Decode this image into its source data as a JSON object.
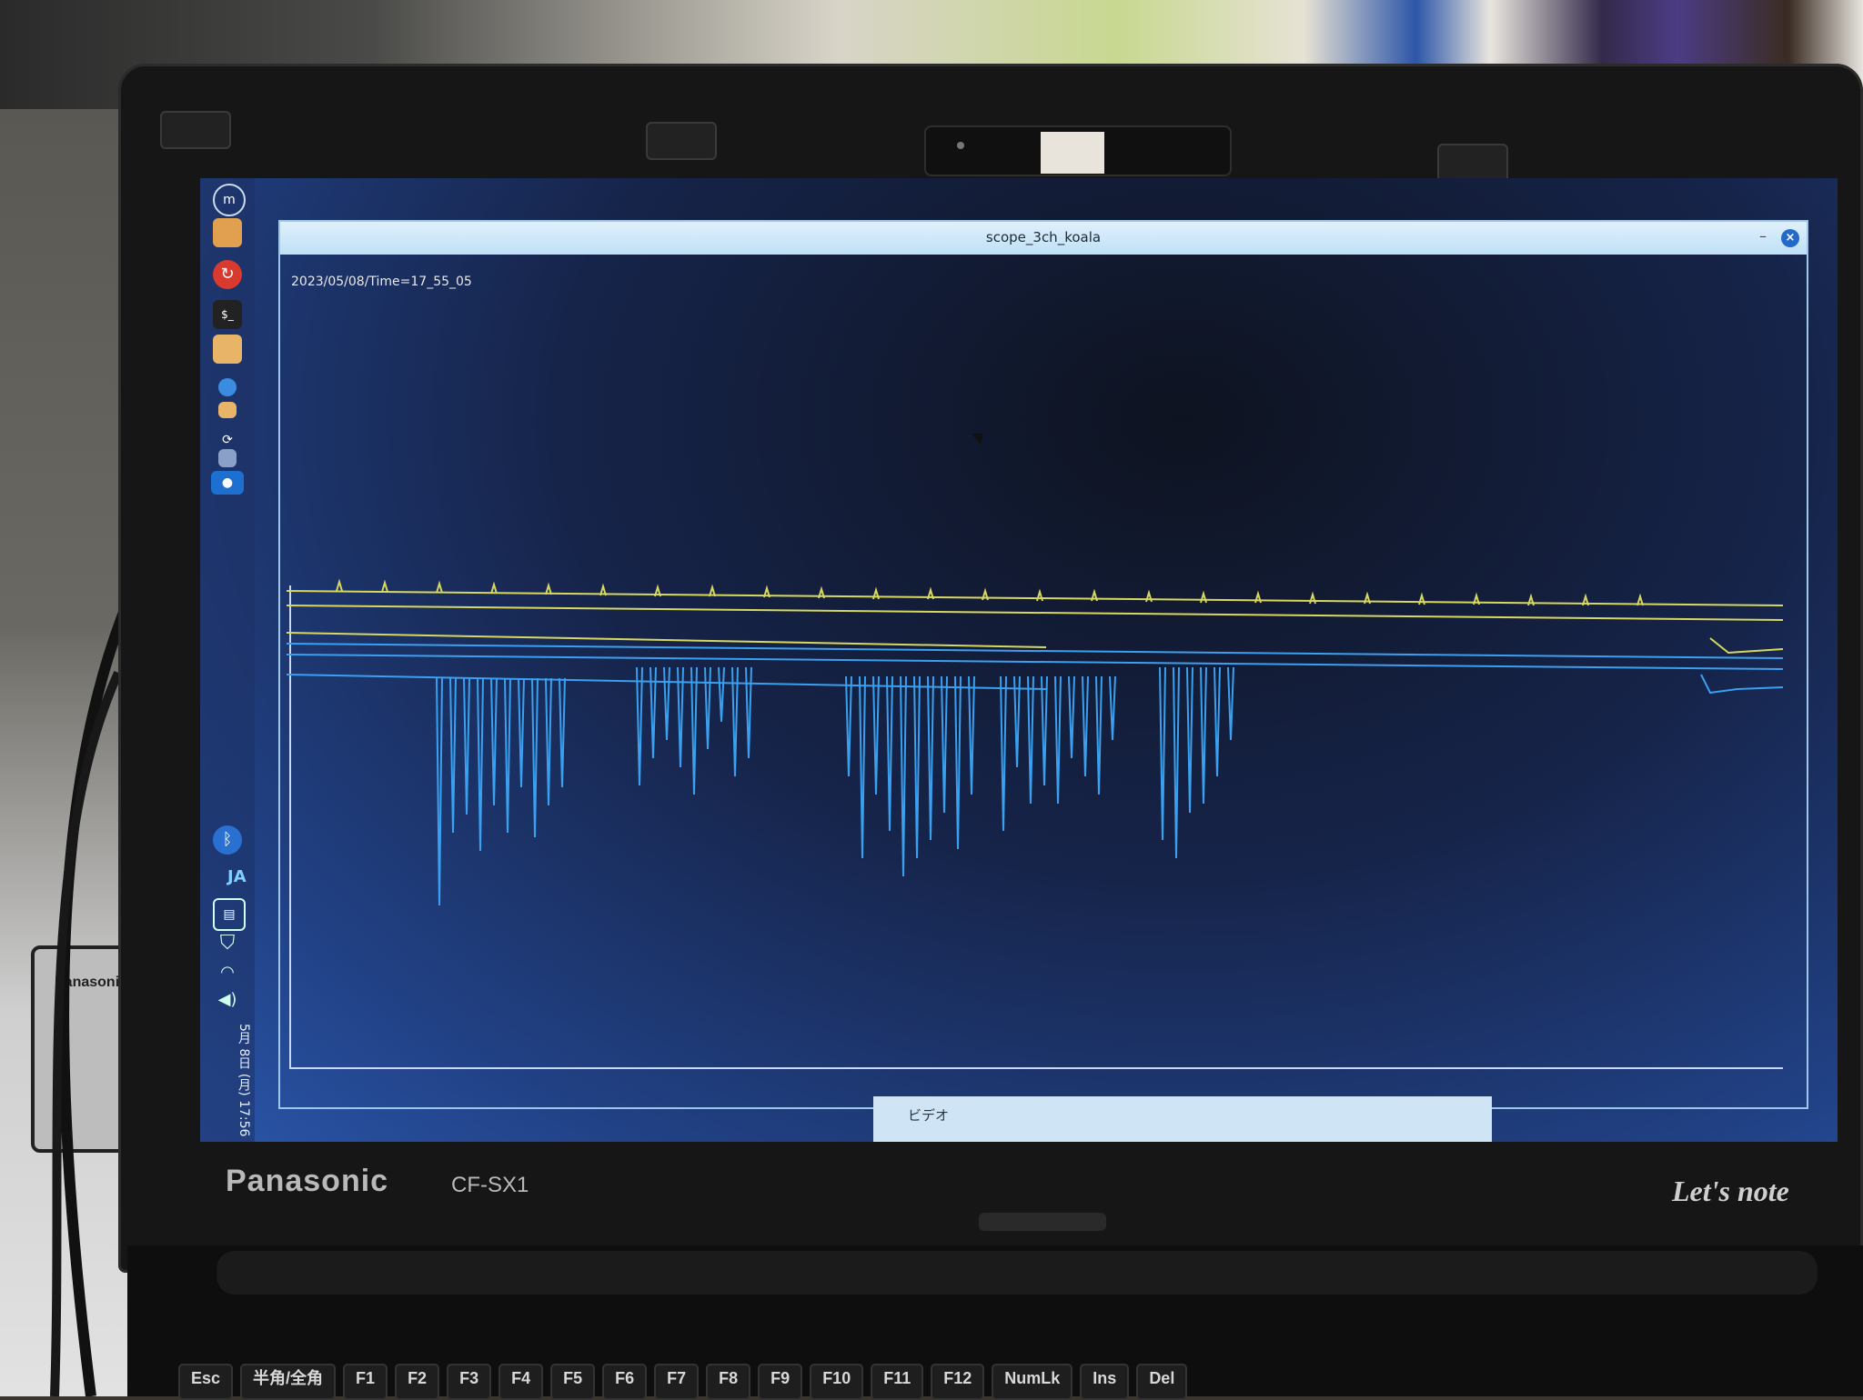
{
  "window": {
    "title": "scope_3ch_koala",
    "minimize_glyph": "–",
    "close_glyph": "×",
    "timestamp": "2023/05/08/Time=17_55_05"
  },
  "panel": {
    "ime_label": "JA",
    "clock": "5月 8日 (月) 17:56",
    "icons": [
      "mint-menu-icon",
      "folder-icon",
      "backup-icon",
      "terminal-icon",
      "files-icon",
      "settings-icon",
      "folder-small-icon",
      "update-icon",
      "save-icon",
      "media-icon"
    ],
    "tray_icons": [
      "bluetooth-icon",
      "clipboard-icon",
      "shield-icon",
      "wifi-icon",
      "volume-icon"
    ]
  },
  "taskbar": {
    "item_label": "ビデオ"
  },
  "laptop": {
    "brand": "Panasonic",
    "model": "CF-SX1",
    "series": "Let's note"
  },
  "adapter": {
    "label": "Panasonic"
  },
  "keyboard": {
    "keys": [
      "Esc",
      "半角/全角",
      "F1",
      "F2",
      "F3",
      "F4",
      "F5",
      "F6",
      "F7",
      "F8",
      "F9",
      "F10",
      "F11",
      "F12",
      "NumLk",
      "Ins",
      "Del"
    ]
  },
  "colors": {
    "trace_yellow": "#d8d860",
    "trace_blue": "#3aa0f0",
    "title_bar": "#cfe8f8"
  }
}
